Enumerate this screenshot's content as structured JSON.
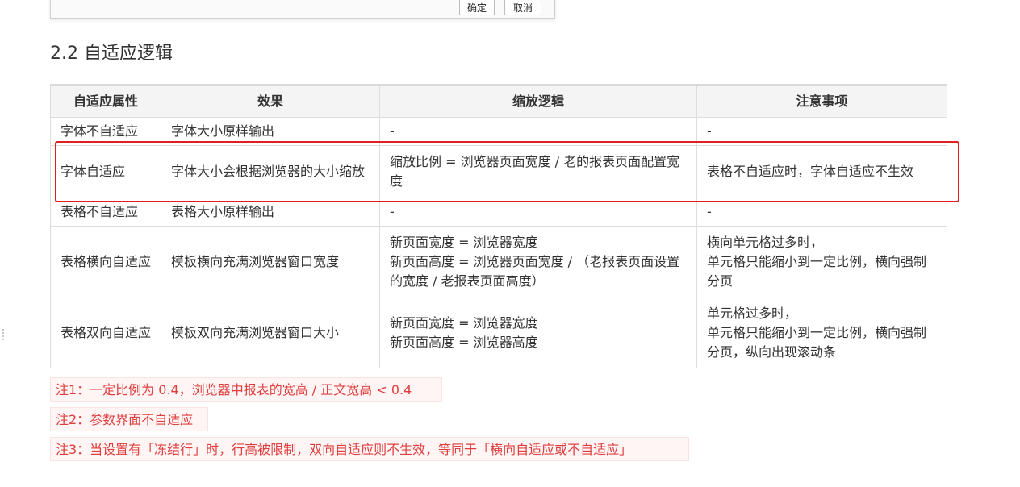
{
  "dialog": {
    "ok_label": "确定",
    "cancel_label": "取消"
  },
  "section": {
    "title": "2.2 自适应逻辑"
  },
  "table": {
    "headers": [
      "自适应属性",
      "效果",
      "缩放逻辑",
      "注意事项"
    ],
    "rows": [
      {
        "property": "字体不自适应",
        "effect": "字体大小原样输出",
        "logic": [
          "-"
        ],
        "notes": [
          "-"
        ]
      },
      {
        "property": "字体自适应",
        "effect": "字体大小会根据浏览器的大小缩放",
        "logic": [
          "缩放比例 = 浏览器页面宽度 / 老的报表页面配置宽度"
        ],
        "notes": [
          "表格不自适应时，字体自适应不生效"
        ]
      },
      {
        "property": "表格不自适应",
        "effect": "表格大小原样输出",
        "logic": [
          "-"
        ],
        "notes": [
          "-"
        ]
      },
      {
        "property": "表格横向自适应",
        "effect": "模板横向充满浏览器窗口宽度",
        "logic": [
          "新页面宽度 = 浏览器宽度",
          "新页面高度 = 浏览器页面宽度 / （老报表页面设置的宽度 / 老报表页面高度）"
        ],
        "notes": [
          "横向单元格过多时，",
          "单元格只能缩小到一定比例，横向强制分页"
        ]
      },
      {
        "property": "表格双向自适应",
        "effect": "模板双向充满浏览器窗口大小",
        "logic": [
          "新页面宽度 = 浏览器宽度",
          "新页面高度 = 浏览器高度"
        ],
        "notes": [
          "单元格过多时，",
          "单元格只能缩小到一定比例，横向强制分页，纵向出现滚动条"
        ]
      }
    ]
  },
  "notes": [
    "注1：一定比例为 0.4，浏览器中报表的宽高 / 正文宽高 < 0.4",
    "注2：参数界面不自适应",
    "注3：当设置有「冻结行」时，行高被限制，双向自适应则不生效，等同于「横向自适应或不自适应」"
  ],
  "colors": {
    "highlight": "#e02020",
    "note_text": "#e03e3e",
    "note_bg": "#fff5f5",
    "header_bg": "#f4f4f4"
  }
}
